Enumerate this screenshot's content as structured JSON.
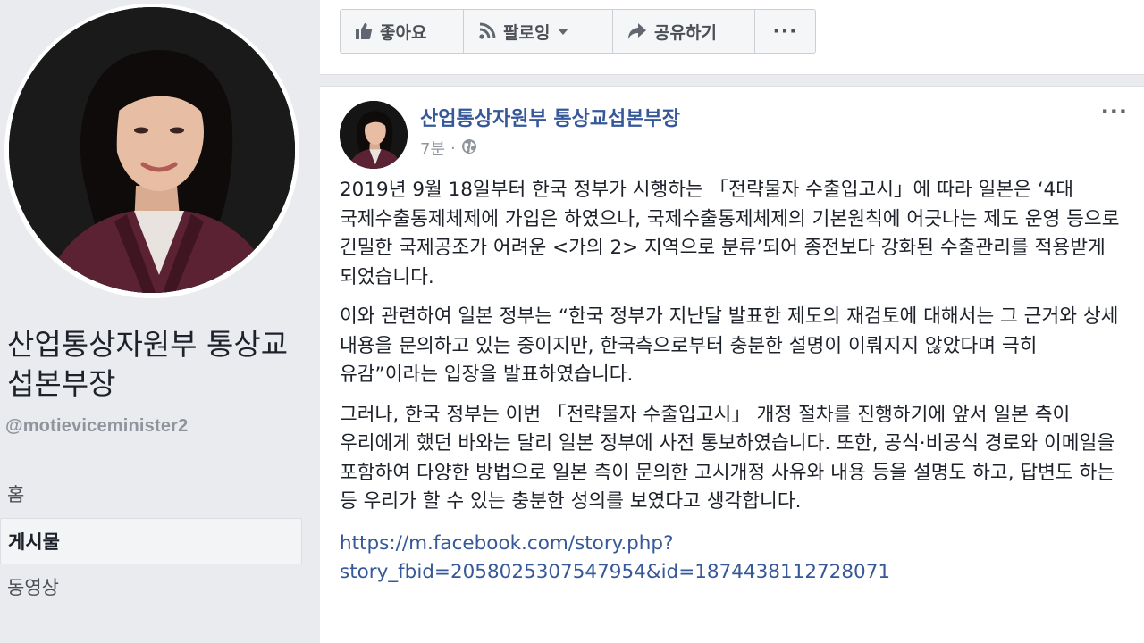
{
  "sidebar": {
    "page_name": "산업통상자원부 통상교섭본부장",
    "handle": "@motieviceminister2",
    "nav": [
      {
        "label": "홈",
        "active": false
      },
      {
        "label": "게시물",
        "active": true
      },
      {
        "label": "동영상",
        "active": false
      }
    ]
  },
  "actions": {
    "like_label": "좋아요",
    "follow_label": "팔로잉",
    "share_label": "공유하기",
    "more_label": "···"
  },
  "post": {
    "author": "산업통상자원부 통상교섭본부장",
    "time": "7분",
    "separator": "·",
    "privacy_icon": "globe-icon",
    "menu_label": "···",
    "paragraphs": [
      "2019년 9월 18일부터 한국 정부가 시행하는 「전략물자 수출입고시」에 따라 일본은 ‘4대 국제수출통제체제에 가입은 하였으나, 국제수출통제체제의 기본원칙에 어긋나는 제도 운영 등으로 긴밀한 국제공조가 어려운 <가의 2> 지역으로 분류’되어 종전보다 강화된 수출관리를 적용받게 되었습니다.",
      "이와 관련하여 일본 정부는 “한국 정부가 지난달 발표한 제도의 재검토에 대해서는 그 근거와 상세 내용을 문의하고 있는 중이지만, 한국측으로부터 충분한 설명이 이뤄지지 않았다며 극히 유감”이라는 입장을 발표하였습니다.",
      "그러나, 한국 정부는 이번 「전략물자 수출입고시」 개정 절차를 진행하기에 앞서 일본 측이 우리에게 했던 바와는 달리 일본 정부에 사전 통보하였습니다. 또한, 공식·비공식 경로와 이메일을 포함하여 다양한 방법으로 일본 측이 문의한 고시개정 사유와 내용 등을 설명도 하고, 답변도 하는 등 우리가 할 수 있는 충분한 성의를 보였다고 생각합니다."
    ],
    "link": "https://m.facebook.com/story.php?story_fbid=2058025307547954&id=1874438112728071"
  },
  "colors": {
    "link": "#365899",
    "background": "#e9ebee",
    "card": "#ffffff"
  }
}
